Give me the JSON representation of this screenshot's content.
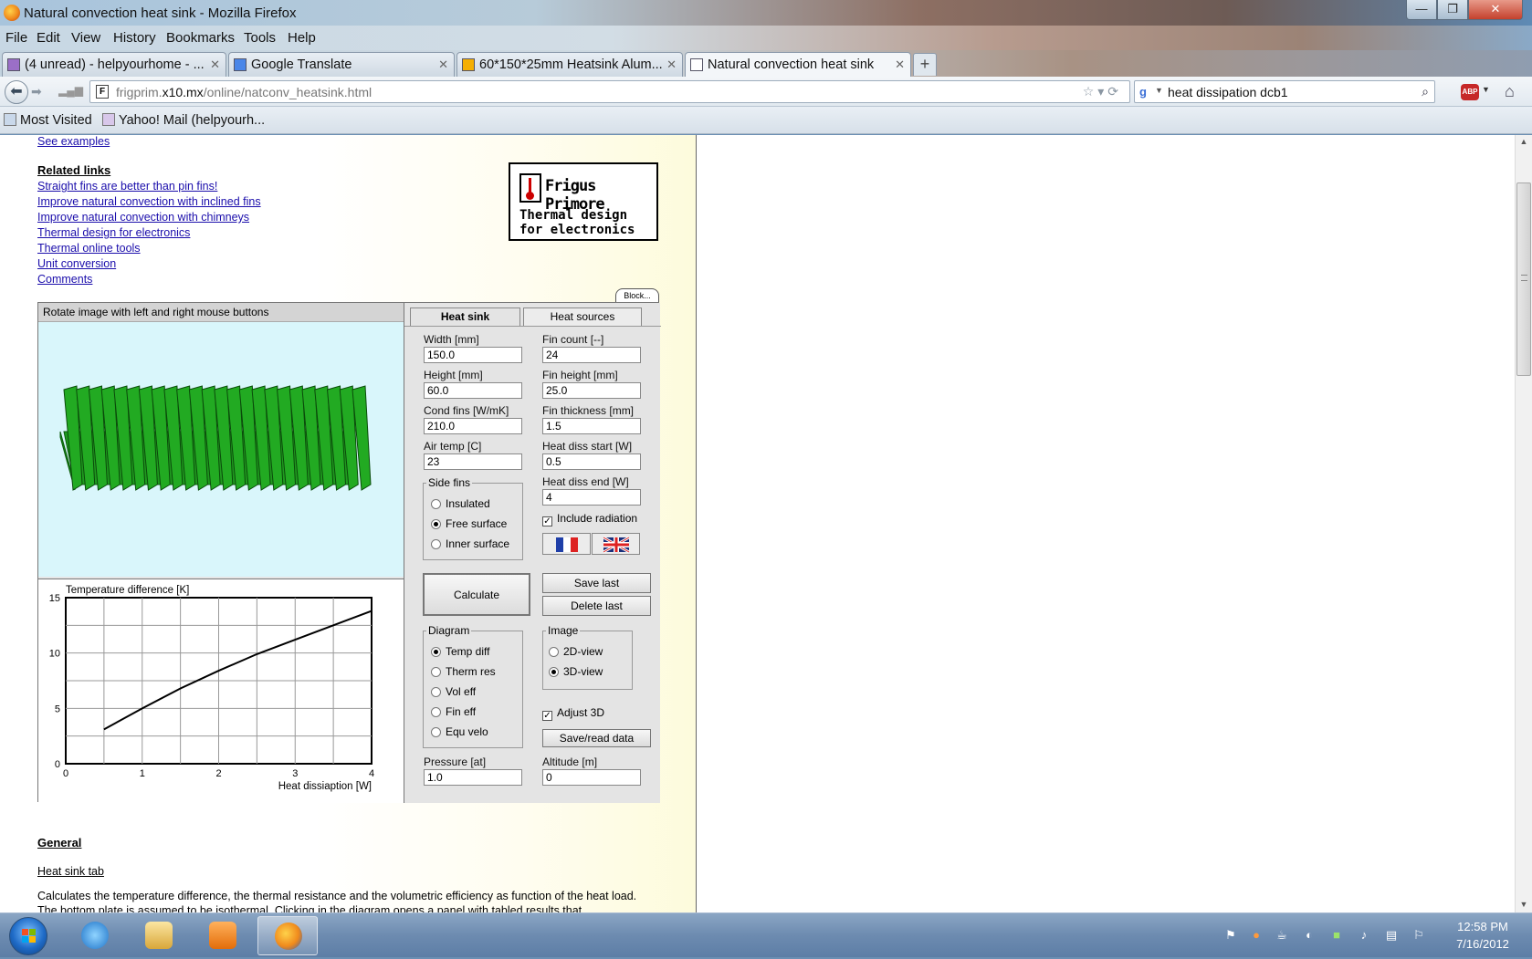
{
  "window": {
    "title": "Natural convection heat sink - Mozilla Firefox",
    "controls": {
      "minimize": "—",
      "maximize": "❐",
      "close": "✕"
    }
  },
  "menu": [
    "File",
    "Edit",
    "View",
    "History",
    "Bookmarks",
    "Tools",
    "Help"
  ],
  "tabs": [
    {
      "label": "(4 unread) - helpyourhome - ...",
      "active": false
    },
    {
      "label": "Google Translate",
      "active": false
    },
    {
      "label": "60*150*25mm Heatsink Alum...",
      "active": false
    },
    {
      "label": "Natural convection heat sink",
      "active": true
    }
  ],
  "nav": {
    "url_prefix": "frigprim.",
    "url_domain": "x10.mx",
    "url_path": "/online/natconv_heatsink.html",
    "search_query": "heat dissipation dcb1"
  },
  "bookmarks": [
    "Most Visited",
    "Yahoo! Mail (helpyourh..."
  ],
  "page": {
    "top_link": "See examples",
    "related_title": "Related links",
    "related_links": [
      "Straight fins are better than pin fins!",
      "Improve natural convection with inclined fins",
      "Improve natural convection with chimneys",
      "Thermal design for electronics",
      "Thermal online tools",
      "Unit conversion",
      "Comments"
    ],
    "logo": {
      "brand": "Frigus Primore",
      "line1": "Thermal design",
      "line2": "for electronics"
    },
    "block_button": "Block...",
    "general_title": "General",
    "heatsink_tab_title": "Heat sink tab",
    "paragraph": "Calculates the temperature difference, the thermal resistance and the volumetric efficiency as function of the heat load. The bottom plate is assumed to be isothermal. Clicking in the diagram opens a panel with tabled results that"
  },
  "app": {
    "hint": "Rotate image with left and right mouse buttons",
    "tabs": [
      "Heat sink",
      "Heat sources"
    ],
    "fields": {
      "width_label": "Width [mm]",
      "width": "150.0",
      "fin_count_label": "Fin count [--]",
      "fin_count": "24",
      "height_label": "Height [mm]",
      "height": "60.0",
      "fin_height_label": "Fin height [mm]",
      "fin_height": "25.0",
      "cond_label": "Cond fins [W/mK]",
      "cond": "210.0",
      "fin_thick_label": "Fin thickness [mm]",
      "fin_thick": "1.5",
      "air_temp_label": "Air temp [C]",
      "air_temp": "23",
      "diss_start_label": "Heat diss start [W]",
      "diss_start": "0.5",
      "diss_end_label": "Heat diss end [W]",
      "diss_end": "4",
      "pressure_label": "Pressure [at]",
      "pressure": "1.0",
      "altitude_label": "Altitude [m]",
      "altitude": "0"
    },
    "side_fins": {
      "legend": "Side fins",
      "options": [
        "Insulated",
        "Free surface",
        "Inner surface"
      ],
      "selected": 1
    },
    "include_radiation": "Include radiation",
    "adjust_3d": "Adjust 3D",
    "buttons": {
      "calculate": "Calculate",
      "save_last": "Save last",
      "delete_last": "Delete last",
      "save_read": "Save/read data"
    },
    "diagram": {
      "legend": "Diagram",
      "options": [
        "Temp diff",
        "Therm res",
        "Vol eff",
        "Fin eff",
        "Equ velo"
      ],
      "selected": 0
    },
    "image": {
      "legend": "Image",
      "options": [
        "2D-view",
        "3D-view"
      ],
      "selected": 1
    },
    "fin_count_visual": 24,
    "fin_color": "#22aa22"
  },
  "chart_data": {
    "type": "line",
    "title": "Temperature difference [K]",
    "xlabel": "Heat dissiaption [W]",
    "ylabel": "",
    "xlim": [
      0,
      4
    ],
    "ylim": [
      0,
      15
    ],
    "xticks": [
      "0",
      "1",
      "2",
      "3",
      "4"
    ],
    "yticks": [
      "0",
      "5",
      "10",
      "15"
    ],
    "grid": true,
    "series": [
      {
        "x": [
          0.5,
          1.0,
          1.5,
          2.0,
          2.5,
          3.0,
          3.5,
          4.0
        ],
        "y": [
          3.1,
          5.0,
          6.8,
          8.4,
          9.9,
          11.2,
          12.5,
          13.8
        ]
      }
    ]
  },
  "taskbar": {
    "time": "12:58 PM",
    "date": "7/16/2012"
  }
}
